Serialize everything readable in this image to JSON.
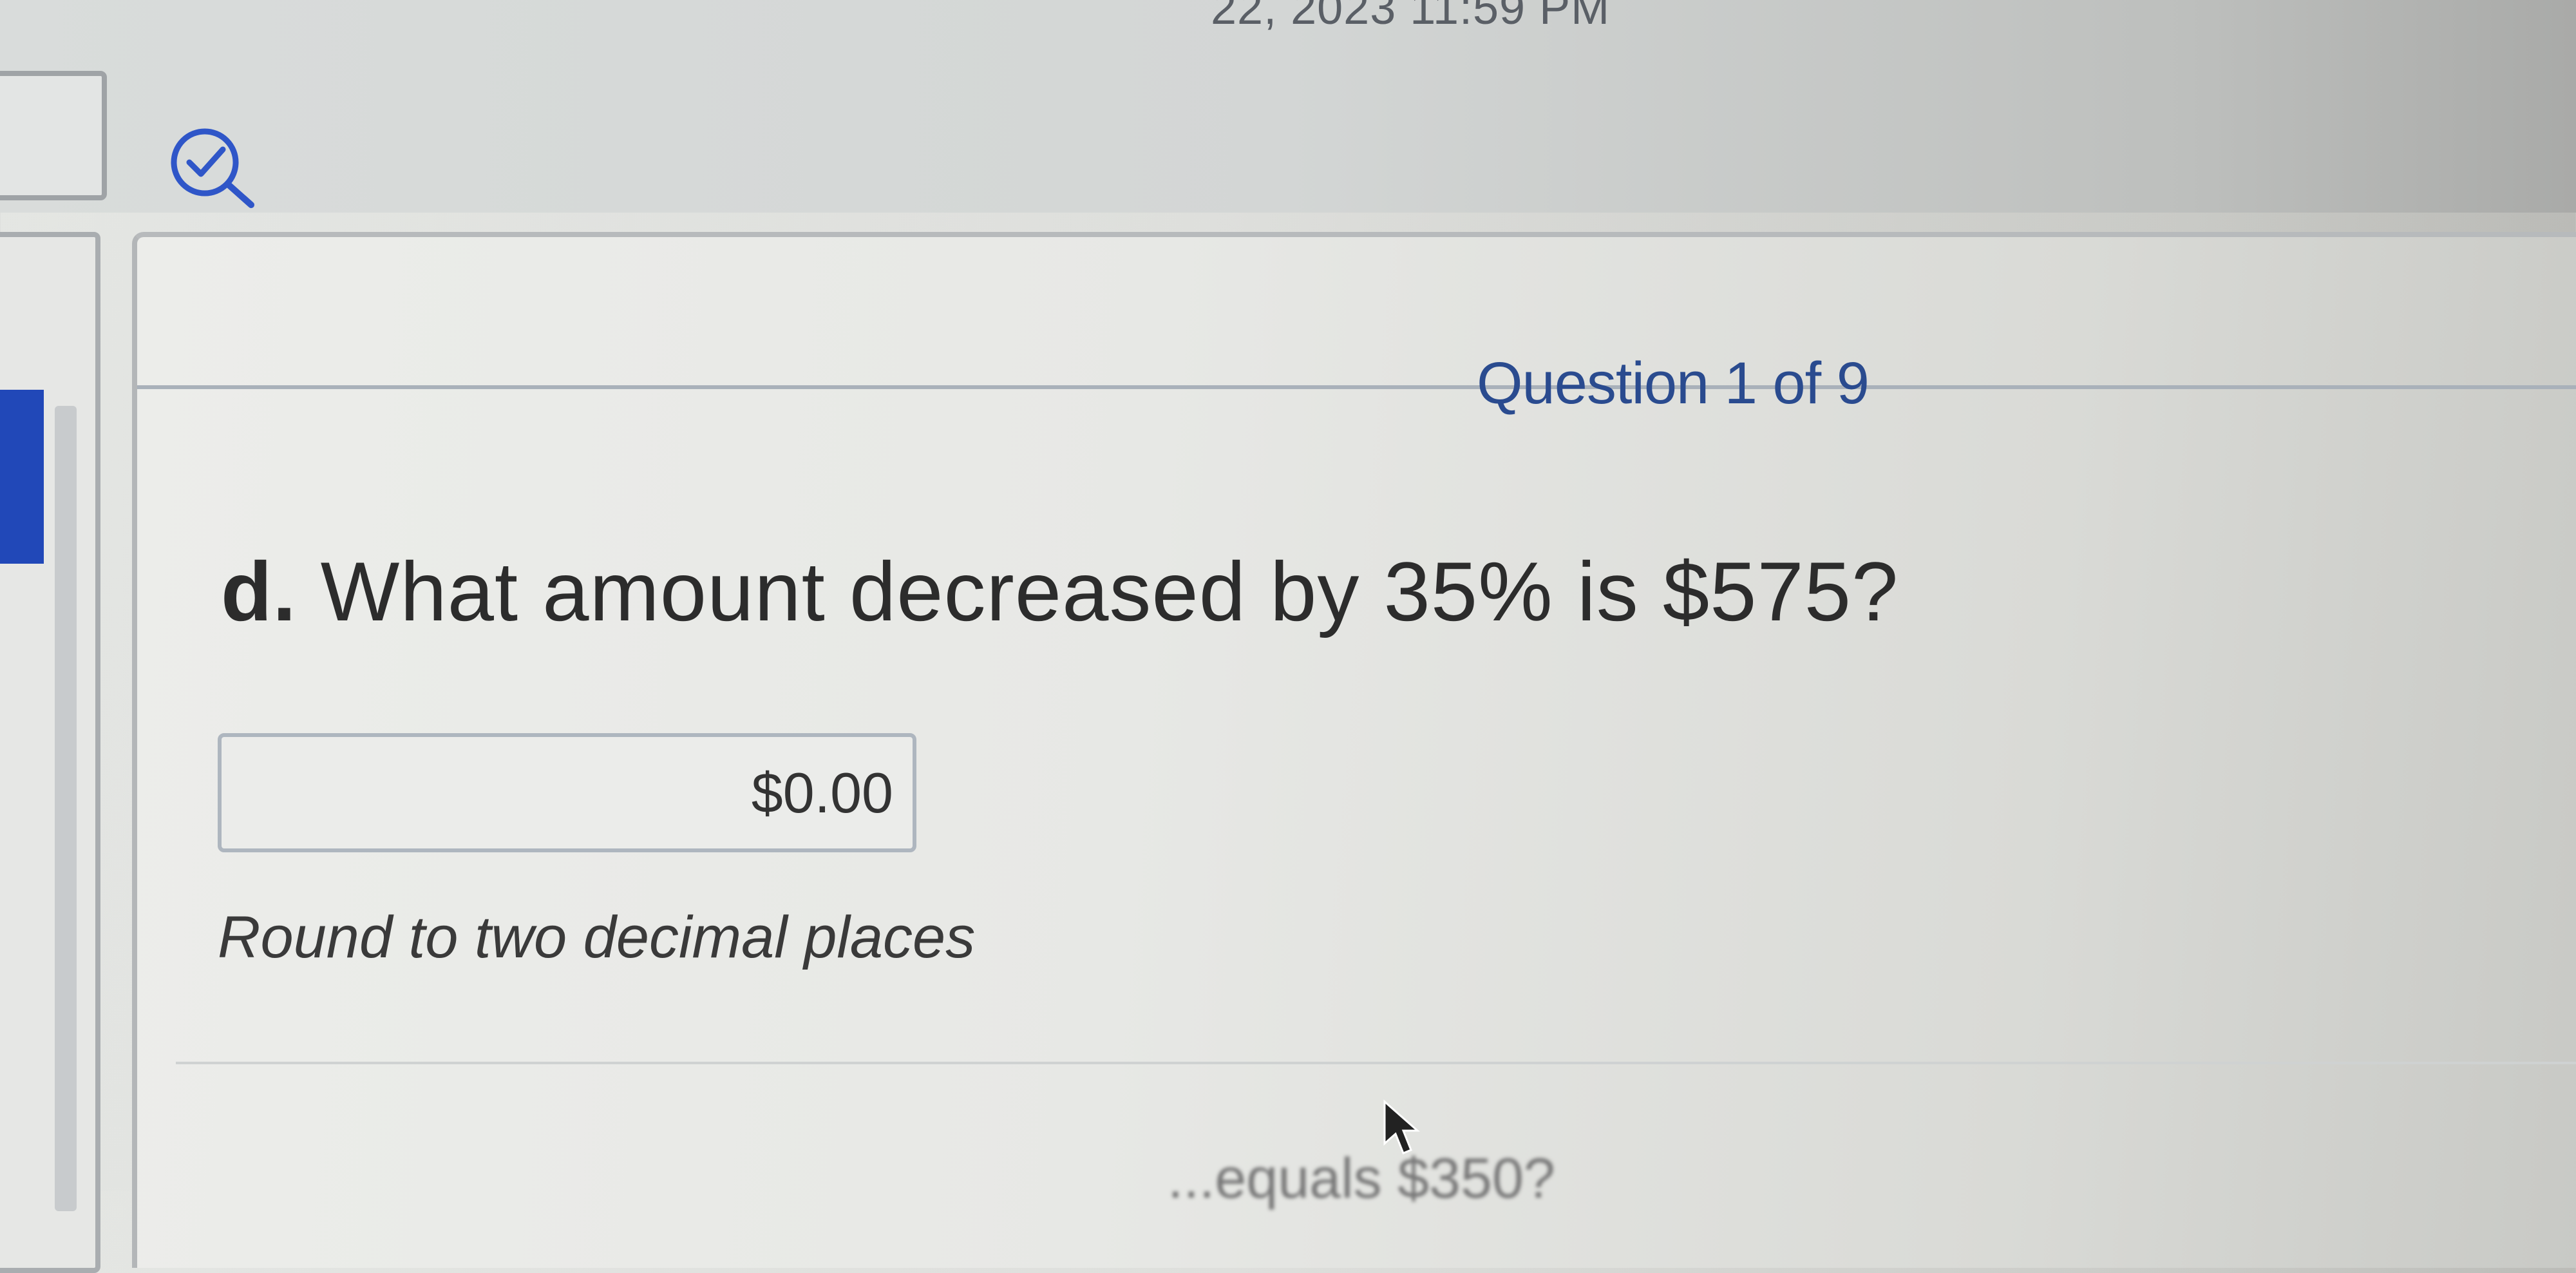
{
  "header": {
    "due_date": "22, 2023 11:59 PM"
  },
  "question": {
    "counter": "Question 1 of 9",
    "letter": "d.",
    "text": "What amount decreased by 35% is $575?",
    "answer_value": "$0.00",
    "hint": "Round to two decimal places"
  },
  "next_question_partial": "...equals $350?",
  "icons": {
    "status": "check-search-icon",
    "cursor": "mouse-pointer-icon"
  },
  "colors": {
    "accent_blue": "#2148b8",
    "counter_text": "#2a4b8f"
  }
}
